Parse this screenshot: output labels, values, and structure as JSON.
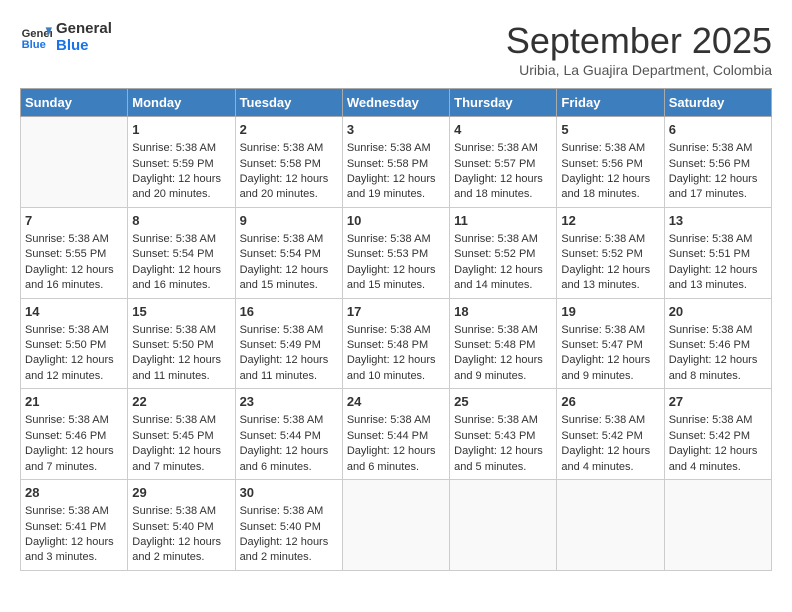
{
  "header": {
    "logo_line1": "General",
    "logo_line2": "Blue",
    "month_title": "September 2025",
    "subtitle": "Uribia, La Guajira Department, Colombia"
  },
  "weekdays": [
    "Sunday",
    "Monday",
    "Tuesday",
    "Wednesday",
    "Thursday",
    "Friday",
    "Saturday"
  ],
  "weeks": [
    [
      {
        "day": "",
        "content": ""
      },
      {
        "day": "1",
        "content": "Sunrise: 5:38 AM\nSunset: 5:59 PM\nDaylight: 12 hours\nand 20 minutes."
      },
      {
        "day": "2",
        "content": "Sunrise: 5:38 AM\nSunset: 5:58 PM\nDaylight: 12 hours\nand 20 minutes."
      },
      {
        "day": "3",
        "content": "Sunrise: 5:38 AM\nSunset: 5:58 PM\nDaylight: 12 hours\nand 19 minutes."
      },
      {
        "day": "4",
        "content": "Sunrise: 5:38 AM\nSunset: 5:57 PM\nDaylight: 12 hours\nand 18 minutes."
      },
      {
        "day": "5",
        "content": "Sunrise: 5:38 AM\nSunset: 5:56 PM\nDaylight: 12 hours\nand 18 minutes."
      },
      {
        "day": "6",
        "content": "Sunrise: 5:38 AM\nSunset: 5:56 PM\nDaylight: 12 hours\nand 17 minutes."
      }
    ],
    [
      {
        "day": "7",
        "content": "Sunrise: 5:38 AM\nSunset: 5:55 PM\nDaylight: 12 hours\nand 16 minutes."
      },
      {
        "day": "8",
        "content": "Sunrise: 5:38 AM\nSunset: 5:54 PM\nDaylight: 12 hours\nand 16 minutes."
      },
      {
        "day": "9",
        "content": "Sunrise: 5:38 AM\nSunset: 5:54 PM\nDaylight: 12 hours\nand 15 minutes."
      },
      {
        "day": "10",
        "content": "Sunrise: 5:38 AM\nSunset: 5:53 PM\nDaylight: 12 hours\nand 15 minutes."
      },
      {
        "day": "11",
        "content": "Sunrise: 5:38 AM\nSunset: 5:52 PM\nDaylight: 12 hours\nand 14 minutes."
      },
      {
        "day": "12",
        "content": "Sunrise: 5:38 AM\nSunset: 5:52 PM\nDaylight: 12 hours\nand 13 minutes."
      },
      {
        "day": "13",
        "content": "Sunrise: 5:38 AM\nSunset: 5:51 PM\nDaylight: 12 hours\nand 13 minutes."
      }
    ],
    [
      {
        "day": "14",
        "content": "Sunrise: 5:38 AM\nSunset: 5:50 PM\nDaylight: 12 hours\nand 12 minutes."
      },
      {
        "day": "15",
        "content": "Sunrise: 5:38 AM\nSunset: 5:50 PM\nDaylight: 12 hours\nand 11 minutes."
      },
      {
        "day": "16",
        "content": "Sunrise: 5:38 AM\nSunset: 5:49 PM\nDaylight: 12 hours\nand 11 minutes."
      },
      {
        "day": "17",
        "content": "Sunrise: 5:38 AM\nSunset: 5:48 PM\nDaylight: 12 hours\nand 10 minutes."
      },
      {
        "day": "18",
        "content": "Sunrise: 5:38 AM\nSunset: 5:48 PM\nDaylight: 12 hours\nand 9 minutes."
      },
      {
        "day": "19",
        "content": "Sunrise: 5:38 AM\nSunset: 5:47 PM\nDaylight: 12 hours\nand 9 minutes."
      },
      {
        "day": "20",
        "content": "Sunrise: 5:38 AM\nSunset: 5:46 PM\nDaylight: 12 hours\nand 8 minutes."
      }
    ],
    [
      {
        "day": "21",
        "content": "Sunrise: 5:38 AM\nSunset: 5:46 PM\nDaylight: 12 hours\nand 7 minutes."
      },
      {
        "day": "22",
        "content": "Sunrise: 5:38 AM\nSunset: 5:45 PM\nDaylight: 12 hours\nand 7 minutes."
      },
      {
        "day": "23",
        "content": "Sunrise: 5:38 AM\nSunset: 5:44 PM\nDaylight: 12 hours\nand 6 minutes."
      },
      {
        "day": "24",
        "content": "Sunrise: 5:38 AM\nSunset: 5:44 PM\nDaylight: 12 hours\nand 6 minutes."
      },
      {
        "day": "25",
        "content": "Sunrise: 5:38 AM\nSunset: 5:43 PM\nDaylight: 12 hours\nand 5 minutes."
      },
      {
        "day": "26",
        "content": "Sunrise: 5:38 AM\nSunset: 5:42 PM\nDaylight: 12 hours\nand 4 minutes."
      },
      {
        "day": "27",
        "content": "Sunrise: 5:38 AM\nSunset: 5:42 PM\nDaylight: 12 hours\nand 4 minutes."
      }
    ],
    [
      {
        "day": "28",
        "content": "Sunrise: 5:38 AM\nSunset: 5:41 PM\nDaylight: 12 hours\nand 3 minutes."
      },
      {
        "day": "29",
        "content": "Sunrise: 5:38 AM\nSunset: 5:40 PM\nDaylight: 12 hours\nand 2 minutes."
      },
      {
        "day": "30",
        "content": "Sunrise: 5:38 AM\nSunset: 5:40 PM\nDaylight: 12 hours\nand 2 minutes."
      },
      {
        "day": "",
        "content": ""
      },
      {
        "day": "",
        "content": ""
      },
      {
        "day": "",
        "content": ""
      },
      {
        "day": "",
        "content": ""
      }
    ]
  ]
}
